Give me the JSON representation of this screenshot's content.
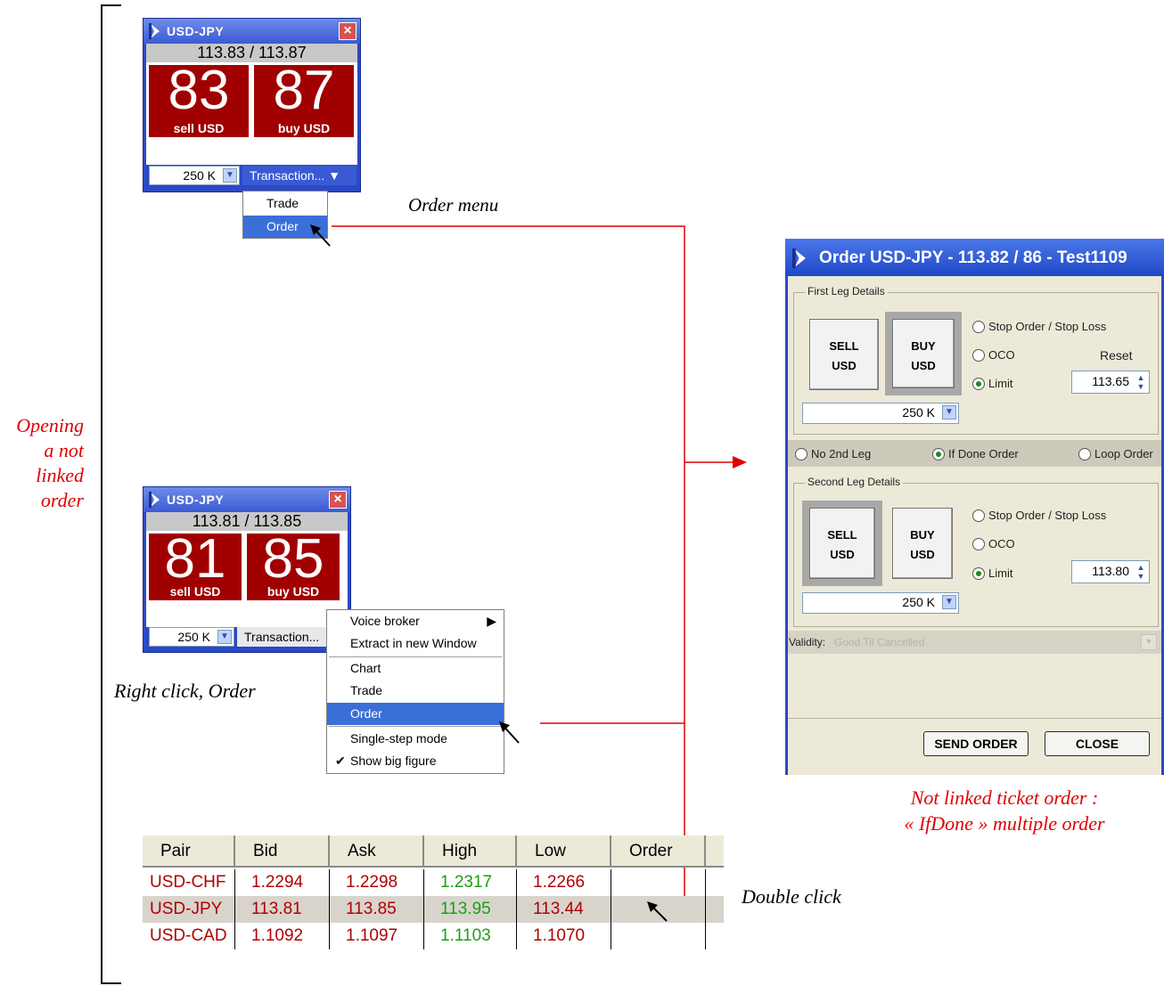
{
  "annotations": {
    "left": [
      "Opening",
      "a not",
      "linked",
      "order"
    ],
    "order_menu": "Order menu",
    "right_click": "Right click, Order",
    "double_click": "Double click",
    "caption_line1": "Not linked ticket order  :",
    "caption_line2": "« IfDone » multiple order"
  },
  "widget_top": {
    "title": "USD-JPY",
    "rate": "113.83 / 113.87",
    "sell_big": "83",
    "sell_label": "sell USD",
    "buy_big": "87",
    "buy_label": "buy USD",
    "quantity": "250 K",
    "transaction": "Transaction... ▼",
    "menu": [
      "Trade",
      "Order"
    ]
  },
  "widget_mid": {
    "title": "USD-JPY",
    "rate": "113.81 / 113.85",
    "sell_big": "81",
    "sell_label": "sell USD",
    "buy_big": "85",
    "buy_label": "buy USD",
    "quantity": "250 K",
    "transaction": "Transaction...",
    "context_menu": {
      "voice_broker": "Voice broker",
      "extract": "Extract in new Window",
      "chart": "Chart",
      "trade": "Trade",
      "order": "Order",
      "single_step": "Single-step mode",
      "show_big": "Show big figure"
    }
  },
  "dialog": {
    "title": "Order USD-JPY - 113.82 / 86 - Test1109",
    "first_leg": {
      "legend": "First Leg Details",
      "sell": [
        "SELL",
        "USD"
      ],
      "buy": [
        "BUY",
        "USD"
      ],
      "options": [
        "Stop Order / Stop Loss",
        "OCO",
        "Limit"
      ],
      "selected": "Limit",
      "reset_label": "Reset",
      "price": "113.65",
      "quantity": "250 K"
    },
    "second_leg_choice": {
      "options": [
        "No 2nd Leg",
        "If Done Order",
        "Loop Order"
      ],
      "selected": "If Done Order"
    },
    "second_leg": {
      "legend": "Second Leg Details",
      "sell": [
        "SELL",
        "USD"
      ],
      "buy": [
        "BUY",
        "USD"
      ],
      "options": [
        "Stop Order / Stop Loss",
        "OCO",
        "Limit"
      ],
      "selected": "Limit",
      "price": "113.80",
      "quantity": "250 K"
    },
    "validity_label": "Validity:",
    "validity_value": "Good Til Cancelled",
    "send_button": "SEND ORDER",
    "close_button": "CLOSE"
  },
  "table": {
    "headers": [
      "Pair",
      "Bid",
      "Ask",
      "High",
      "Low",
      "Order"
    ],
    "rows": [
      [
        "USD-CHF",
        "1.2294",
        "1.2298",
        "1.2317",
        "1.2266",
        ""
      ],
      [
        "USD-JPY",
        "113.81",
        "113.85",
        "113.95",
        "113.44",
        ""
      ],
      [
        "USD-CAD",
        "1.1092",
        "1.1097",
        "1.1103",
        "1.1070",
        ""
      ]
    ]
  },
  "colors": {
    "window_blue": "#2a48c8",
    "price_red": "#a00000",
    "annotation_red": "#e00000",
    "high_green": "#18a018",
    "menu_highlight": "#3a6fd8"
  }
}
